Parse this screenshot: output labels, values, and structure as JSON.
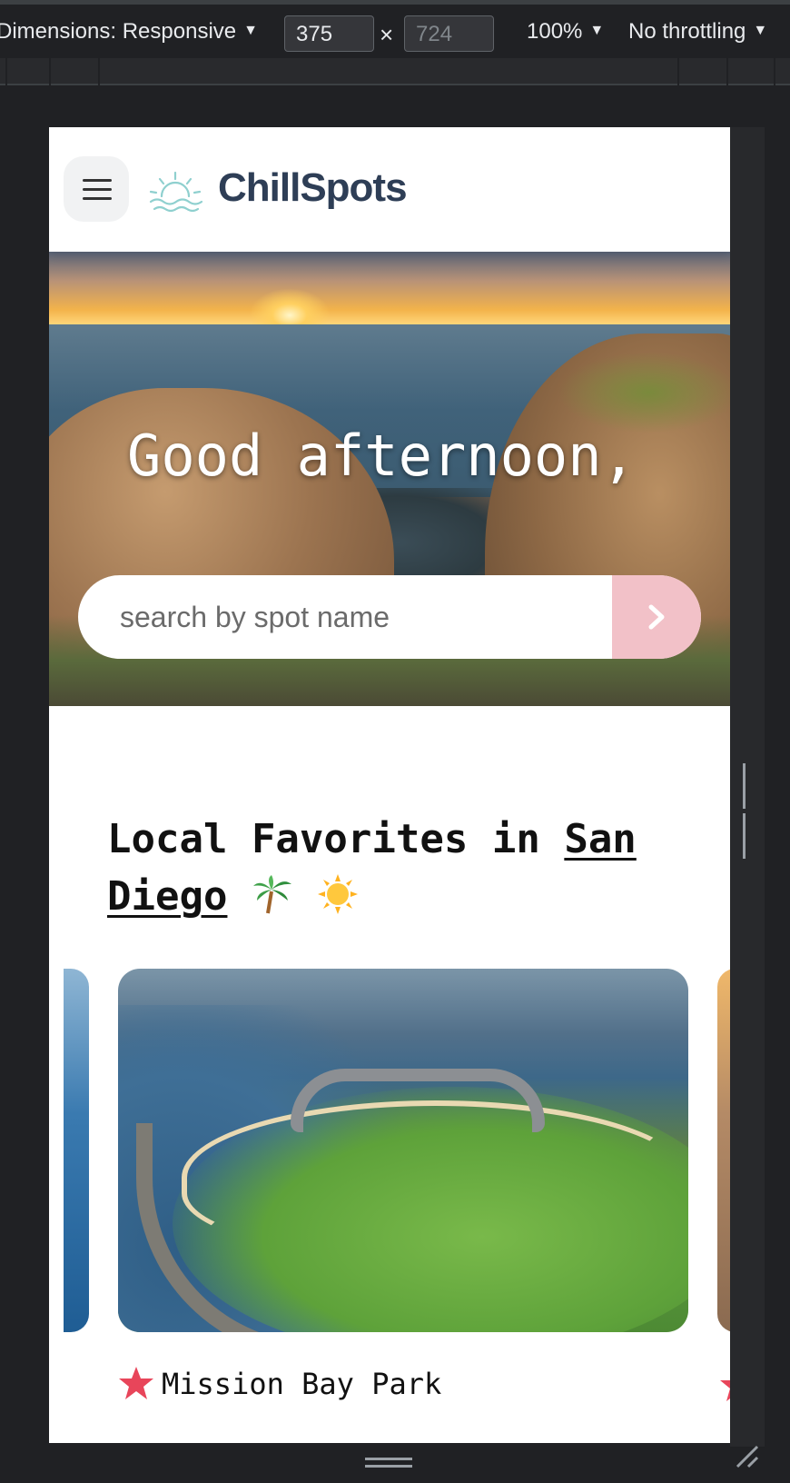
{
  "devtools": {
    "dimensions_label": "Dimensions: Responsive",
    "width_value": "375",
    "height_placeholder": "724",
    "times_symbol": "×",
    "zoom": "100%",
    "throttling": "No throttling"
  },
  "header": {
    "logo_text": "ChillSpots"
  },
  "hero": {
    "greeting": "Good afternoon,",
    "search_placeholder": "search by spot name"
  },
  "favorites": {
    "title_prefix": "Local Favorites in ",
    "city": "San Diego",
    "cards": [
      {
        "name": "Mission Bay Park"
      }
    ]
  },
  "colors": {
    "brand_text": "#2e3e56",
    "search_button": "#f2c1c8",
    "star": "#e8455a",
    "devtools_bg": "#202124"
  },
  "icons": [
    "hamburger-menu-icon",
    "sun-waves-logo-icon",
    "chevron-right-icon",
    "palm-tree-emoji",
    "sun-emoji",
    "star-icon"
  ]
}
